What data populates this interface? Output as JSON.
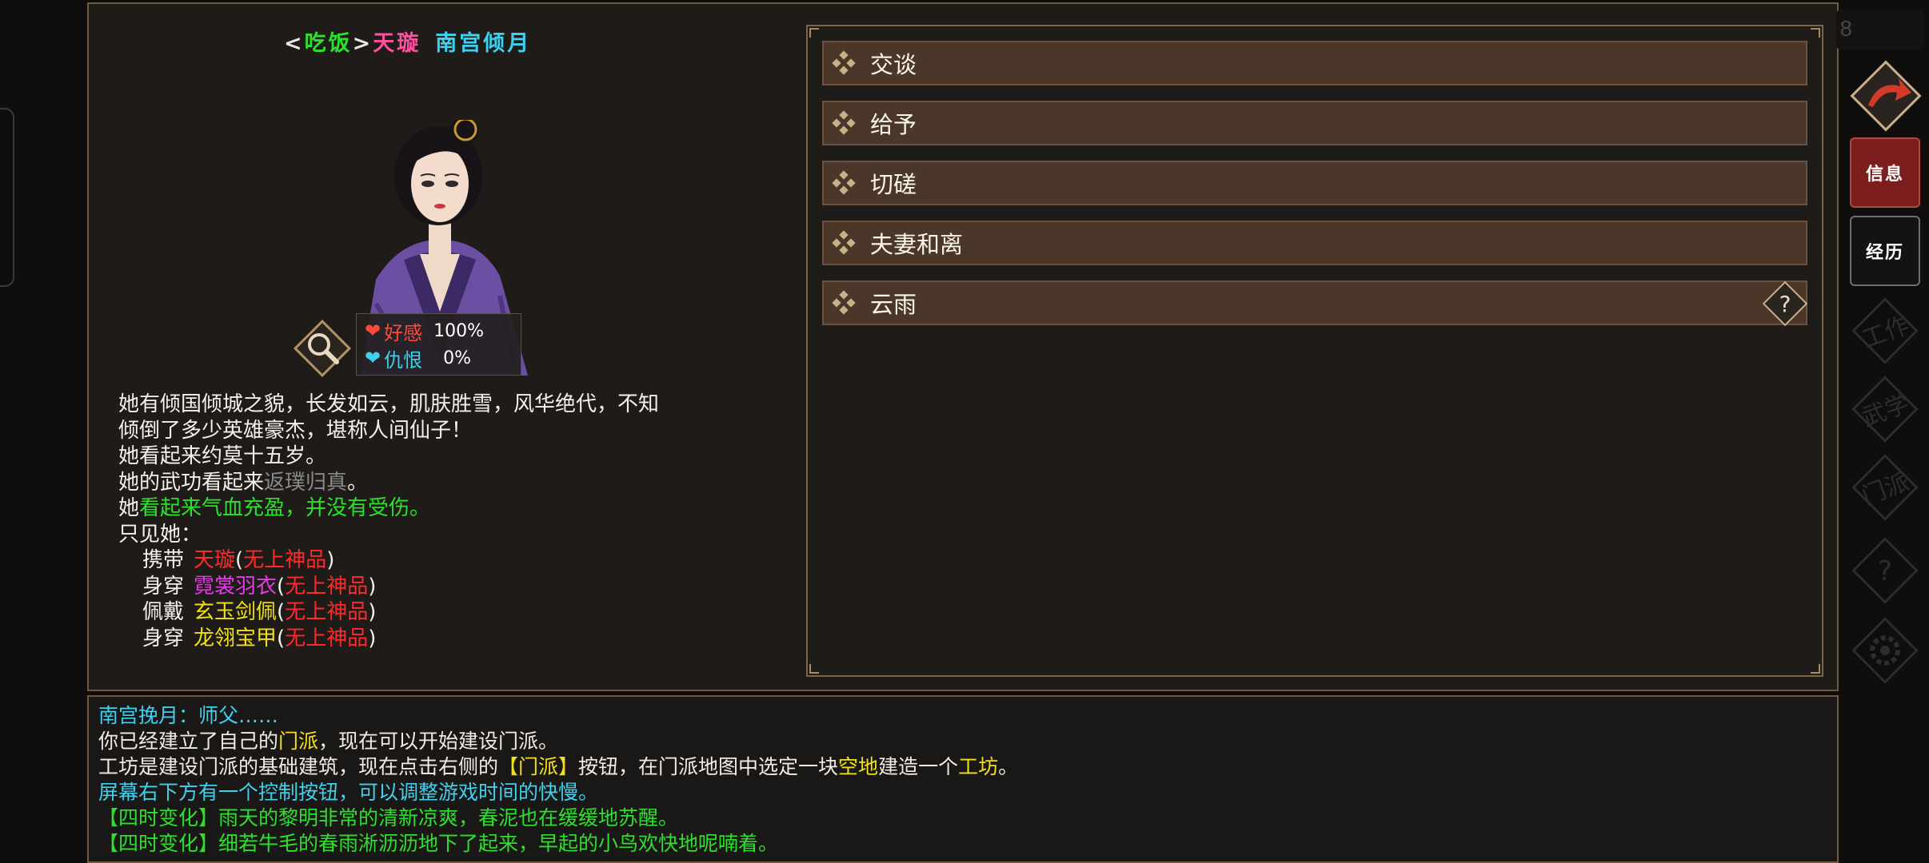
{
  "character": {
    "prefix_open": "<",
    "status": "吃饭",
    "prefix_close": ">",
    "title": "天璇",
    "name": "南宫倾月"
  },
  "affection": {
    "love_label": "好感",
    "love_value": "100%",
    "hate_label": "仇恨",
    "hate_value": "0%"
  },
  "description": {
    "line1": "她有倾国倾城之貌，长发如云，肌肤胜雪，风华绝代，不知",
    "line2": "倾倒了多少英雄豪杰，堪称人间仙子！",
    "line3": "她看起来约莫十五岁。",
    "line4_prefix": "她的武功看起来",
    "line4_level": "返璞归真",
    "line4_suffix": "。",
    "line5_prefix": "她",
    "line5_health": "看起来气血充盈，并没有受伤。",
    "line6": "只见她：",
    "equipment": [
      {
        "label": "携带",
        "item": "天璇",
        "grade": "无上神品",
        "item_color": "#ff2a2a"
      },
      {
        "label": "身穿",
        "item": "霓裳羽衣",
        "grade": "无上神品",
        "item_color": "#e23ce6"
      },
      {
        "label": "佩戴",
        "item": "玄玉剑佩",
        "grade": "无上神品",
        "item_color": "#f2e019"
      },
      {
        "label": "身穿",
        "item": "龙翎宝甲",
        "grade": "无上神品",
        "item_color": "#f2e019"
      }
    ],
    "paren_open": "(",
    "paren_close": ")"
  },
  "options": [
    {
      "label": "交谈"
    },
    {
      "label": "给予"
    },
    {
      "label": "切磋"
    },
    {
      "label": "夫妻和离"
    },
    {
      "label": "云雨"
    }
  ],
  "help_glyph": "?",
  "log": {
    "line1": "南宫挽月：师父……",
    "line2_a": "你已经建立了自己的",
    "line2_b": "门派",
    "line2_c": "，现在可以开始建设门派。",
    "line3_a": "工坊是建设门派的基础建筑，现在点击右侧的",
    "line3_b": "【门派】",
    "line3_c": "按钮，在门派地图中选定一块",
    "line3_d": "空地",
    "line3_e": "建造一个",
    "line3_f": "工坊",
    "line3_g": "。",
    "line4": "屏幕右下方有一个控制按钮，可以调整游戏时间的快慢。",
    "line5_tag": "【四时变化】",
    "line5_text": "雨天的黎明非常的清新凉爽，春泥也在缓缓地苏醒。",
    "line6_tag": "【四时变化】",
    "line6_text": "细若牛毛的春雨淅沥沥地下了起来，早起的小鸟欢快地呢喃着。"
  },
  "sidebar": {
    "clock_digit": "8",
    "info": "信息",
    "history": "经历",
    "work": "工作",
    "martial": "武学",
    "sect": "门派",
    "help": "?"
  },
  "colors": {
    "cyan": "#3fd0ee",
    "green": "#2de02d",
    "yellow": "#f2e019",
    "red": "#ff2a2a",
    "pink": "#ff4fa0",
    "gray": "#8a8a8a",
    "option_bg": "#4a372a",
    "panel_bg": "#1e1b18",
    "info_button": "#7c1e1e"
  }
}
